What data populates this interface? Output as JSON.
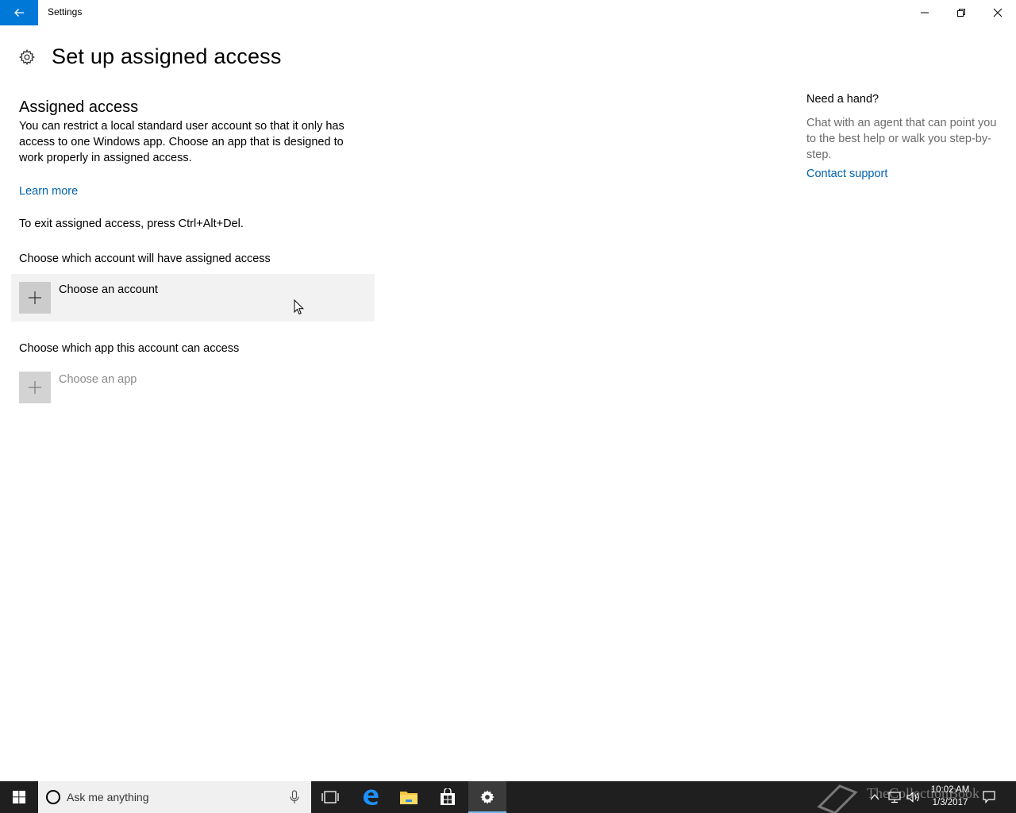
{
  "window": {
    "title": "Settings",
    "accent": "#0078d7"
  },
  "header": {
    "title": "Set up assigned access",
    "icon": "gear-icon"
  },
  "main": {
    "section_title": "Assigned access",
    "description": "You can restrict a local standard user account so that it only has access to one Windows app. Choose an app that is designed to work properly in assigned access.",
    "learn_more": "Learn more",
    "exit_note": "To exit assigned access, press Ctrl+Alt+Del.",
    "account_label": "Choose which account will have assigned access",
    "account_button": "Choose an account",
    "app_label": "Choose which app this account can access",
    "app_button": "Choose an app"
  },
  "help": {
    "title": "Need a hand?",
    "description": "Chat with an agent that can point you to the best help or walk you step-by-step.",
    "link": "Contact support"
  },
  "taskbar": {
    "search_placeholder": "Ask me anything",
    "clock_time": "10:02 AM",
    "clock_date": "1/3/2017",
    "watermark": "TheCollectionBook",
    "pinned": [
      "task-view-icon",
      "edge-icon",
      "file-explorer-icon",
      "store-icon",
      "settings-icon"
    ]
  }
}
